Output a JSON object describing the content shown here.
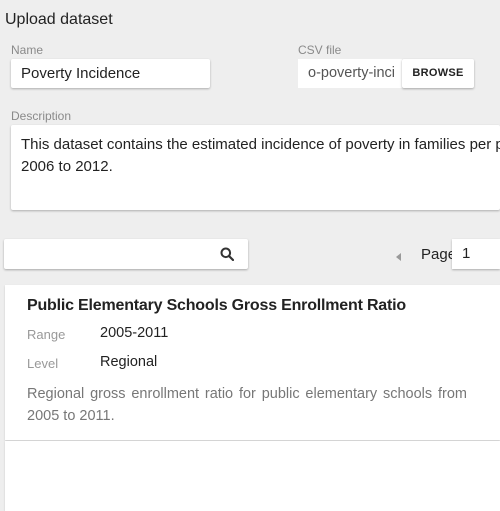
{
  "header": {
    "title": "Upload dataset"
  },
  "form": {
    "name_label": "Name",
    "name_value": "Poverty Incidence",
    "csv_label": "CSV file",
    "csv_value": "o-poverty-inci",
    "browse_label": "BROWSE",
    "description_label": "Description",
    "description_lines": [
      "This dataset contains the estimated incidence of poverty in families per prov",
      "2006 to 2012."
    ]
  },
  "search": {
    "value": "",
    "icon": "search-icon"
  },
  "pager": {
    "label": "Page",
    "value": "1",
    "prev_icon": "triangle-left-icon"
  },
  "dataset_card": {
    "title": "Public Elementary Schools Gross Enrollment Ratio",
    "range_label": "Range",
    "range_value": "2005-2011",
    "level_label": "Level",
    "level_value": "Regional",
    "description_lines": [
      "Regional gross enrollment ratio for public elementary schools from",
      "2005 to 2011."
    ]
  }
}
